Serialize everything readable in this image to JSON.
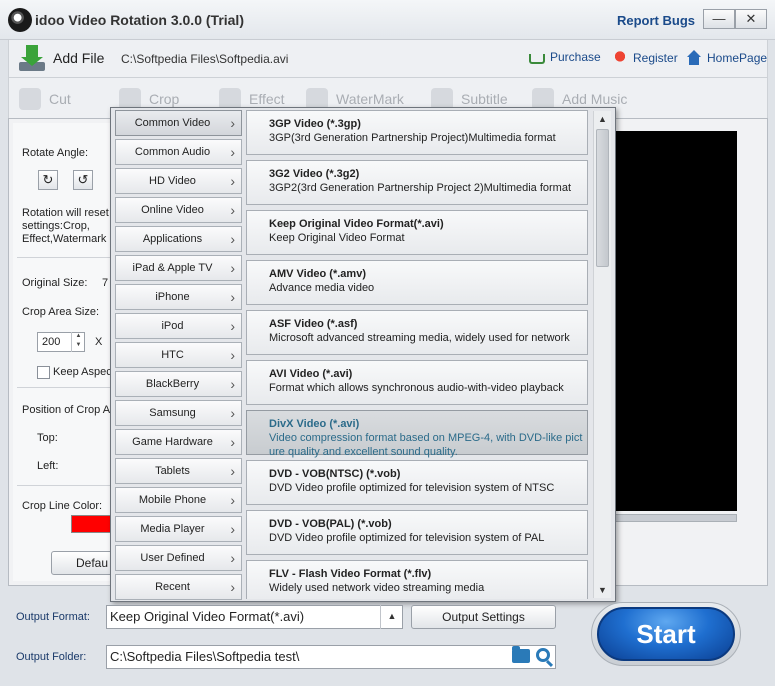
{
  "window": {
    "title": "idoo Video Rotation 3.0.0 (Trial)",
    "report_bugs": "Report Bugs",
    "minimize": "—",
    "close": "✕"
  },
  "toolbar": {
    "add_file": "Add File",
    "file_path": "C:\\Softpedia Files\\Softpedia.avi",
    "purchase": "Purchase",
    "register": "Register",
    "homepage": "HomePage"
  },
  "tools": {
    "cut": "Cut",
    "crop": "Crop",
    "effect": "Effect",
    "watermark": "WaterMark",
    "subtitle": "Subtitle",
    "add_music": "Add Music"
  },
  "left_panel": {
    "rotate_angle": "Rotate Angle:",
    "rotation_note_1": "Rotation will reset",
    "rotation_note_2": "settings:Crop,",
    "rotation_note_3": "Effect,Watermark",
    "original_size": "Original Size:",
    "original_size_value": "7",
    "crop_area_size": "Crop Area Size:",
    "crop_width": "200",
    "crop_x": "X",
    "keep_aspect": "Keep Aspec",
    "position_label": "Position of Crop A",
    "top_label": "Top:",
    "left_label": "Left:",
    "crop_line_color": "Crop Line Color:",
    "crop_line_color_value": "#ff0000",
    "default_button": "Defau"
  },
  "categories": [
    "Common Video",
    "Common Audio",
    "HD Video",
    "Online Video",
    "Applications",
    "iPad & Apple TV",
    "iPhone",
    "iPod",
    "HTC",
    "BlackBerry",
    "Samsung",
    "Game Hardware",
    "Tablets",
    "Mobile Phone",
    "Media Player",
    "User Defined",
    "Recent"
  ],
  "active_category": "Common Video",
  "formats": [
    {
      "name": "3GP Video (*.3gp)",
      "desc": "3GP(3rd Generation Partnership Project)Multimedia format"
    },
    {
      "name": "3G2 Video (*.3g2)",
      "desc": "3GP2(3rd Generation Partnership Project 2)Multimedia format"
    },
    {
      "name": "Keep Original Video Format(*.avi)",
      "desc": "Keep Original Video Format"
    },
    {
      "name": "AMV Video (*.amv)",
      "desc": "Advance media video"
    },
    {
      "name": "ASF Video (*.asf)",
      "desc": "Microsoft advanced streaming media, widely used for network"
    },
    {
      "name": "AVI Video (*.avi)",
      "desc": "Format which allows synchronous audio-with-video playback"
    },
    {
      "name": "DivX Video (*.avi)",
      "desc": "Video compression format based on MPEG-4, with DVD-like pict",
      "desc2": "ure quality and excellent sound quality."
    },
    {
      "name": "DVD - VOB(NTSC) (*.vob)",
      "desc": "DVD Video profile optimized for television system of NTSC"
    },
    {
      "name": "DVD - VOB(PAL) (*.vob)",
      "desc": "DVD Video profile optimized for television system of PAL"
    },
    {
      "name": "FLV - Flash Video Format (*.flv)",
      "desc": "Widely used network video streaming media"
    }
  ],
  "highlighted_format": "DivX Video (*.avi)",
  "bottom": {
    "output_format_label": "Output Format:",
    "output_format_value": "Keep Original Video Format(*.avi)",
    "output_settings": "Output Settings",
    "output_folder_label": "Output Folder:",
    "output_folder_value": "C:\\Softpedia Files\\Softpedia test\\",
    "start": "Start"
  }
}
